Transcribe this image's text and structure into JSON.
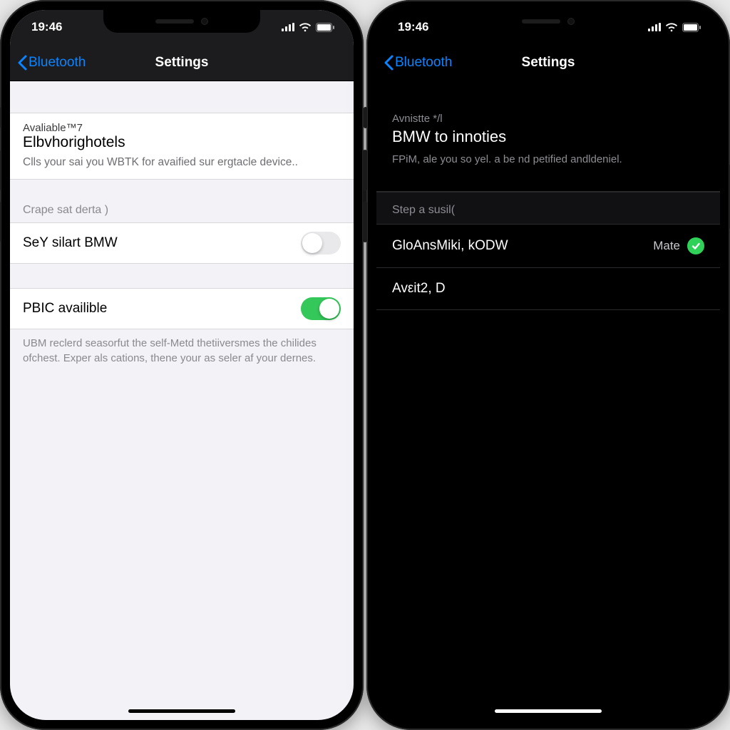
{
  "status": {
    "time": "19:46"
  },
  "nav": {
    "back_label": "Bluetooth",
    "title": "Settings"
  },
  "left": {
    "hero": {
      "overline": "Avaliable™7",
      "headline": "Elbvhorighotels",
      "subtext": "Clls your sai you WBTK for avaified sur ergtacle device.."
    },
    "group1_header": "Crape sat derta )",
    "row1": {
      "label": "SeY silart BMW",
      "on": false
    },
    "row2": {
      "label": "PBIC availible",
      "on": true
    },
    "footer": "UBM reclerd seasorfut the self-Metd thetiiversmes the chilides ofchest. Exper als cations, thene your as seler af your dernes."
  },
  "right": {
    "hero": {
      "overline": "Avnistte */l",
      "headline": "BMW to innoties",
      "subtext": "FPiM, ale you so yel. a be nd petified andldeniel."
    },
    "group_header": "Step a susil(",
    "row1": {
      "label": "GloAnsMiki, kODW",
      "trail": "Mate",
      "checked": true
    },
    "row2": {
      "label": "Avεit2, D"
    }
  }
}
